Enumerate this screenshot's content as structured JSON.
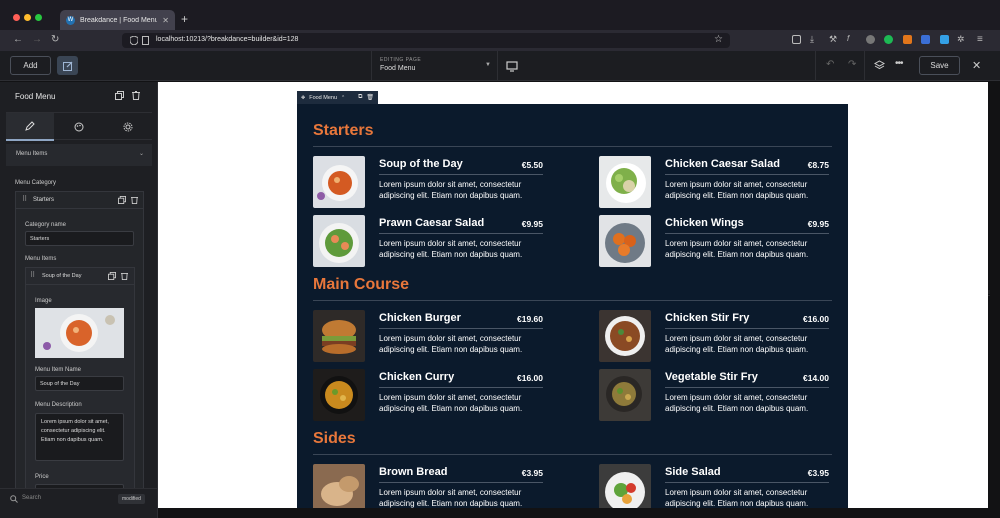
{
  "browser": {
    "tab_title": "Breakdance | Food Menu",
    "url": "localhost:10213/?breakdance=builder&id=128"
  },
  "toolbar": {
    "add_label": "Add",
    "editing_label": "EDITING PAGE",
    "editing_value": "Food Menu",
    "save_label": "Save"
  },
  "panel": {
    "title": "Food Menu",
    "section": "Menu Items",
    "menu_category_label": "Menu Category",
    "category_card_title": "Starters",
    "category_name_label": "Category name",
    "category_name_value": "Starters",
    "menu_items_label": "Menu Items",
    "item_card_title": "Soup of the Day",
    "image_label": "Image",
    "item_name_label": "Menu Item Name",
    "item_name_value": "Soup of the Day",
    "item_desc_label": "Menu Description",
    "item_desc_value": "Lorem ipsum dolor sit amet, consectetur adipiscing elit. Etiam non dapibus quam.",
    "price_label": "Price",
    "search_placeholder": "Search",
    "modified_label": "modified"
  },
  "element_tag": "Food Menu",
  "menu": {
    "description": "Lorem ipsum dolor sit amet, consectetur adipiscing elit. Etiam non dapibus quam.",
    "categories": [
      {
        "title": "Starters",
        "items": [
          {
            "name": "Soup of the Day",
            "price": "€5.50"
          },
          {
            "name": "Chicken Caesar Salad",
            "price": "€8.75"
          },
          {
            "name": "Prawn Caesar Salad",
            "price": "€9.95"
          },
          {
            "name": "Chicken Wings",
            "price": "€9.95"
          }
        ]
      },
      {
        "title": "Main Course",
        "items": [
          {
            "name": "Chicken Burger",
            "price": "€19.60"
          },
          {
            "name": "Chicken Stir Fry",
            "price": "€16.00"
          },
          {
            "name": "Chicken Curry",
            "price": "€16.00"
          },
          {
            "name": "Vegetable Stir Fry",
            "price": "€14.00"
          }
        ]
      },
      {
        "title": "Sides",
        "items": [
          {
            "name": "Brown Bread",
            "price": "€3.95"
          },
          {
            "name": "Side Salad",
            "price": "€3.95"
          }
        ]
      }
    ]
  },
  "colors": {
    "accent": "#e8773b",
    "menu_bg": "#0b1a2c",
    "panel_bg": "#1e1f23"
  },
  "icons": [
    "back-icon",
    "forward-icon",
    "reload-icon",
    "shield-icon",
    "star-icon",
    "pencil-icon",
    "palette-icon",
    "gear-icon",
    "undo-icon",
    "redo-icon",
    "layers-icon",
    "more-icon",
    "close-icon",
    "desktop-icon",
    "copy-icon",
    "trash-icon",
    "drag-handle-icon",
    "search-icon"
  ]
}
